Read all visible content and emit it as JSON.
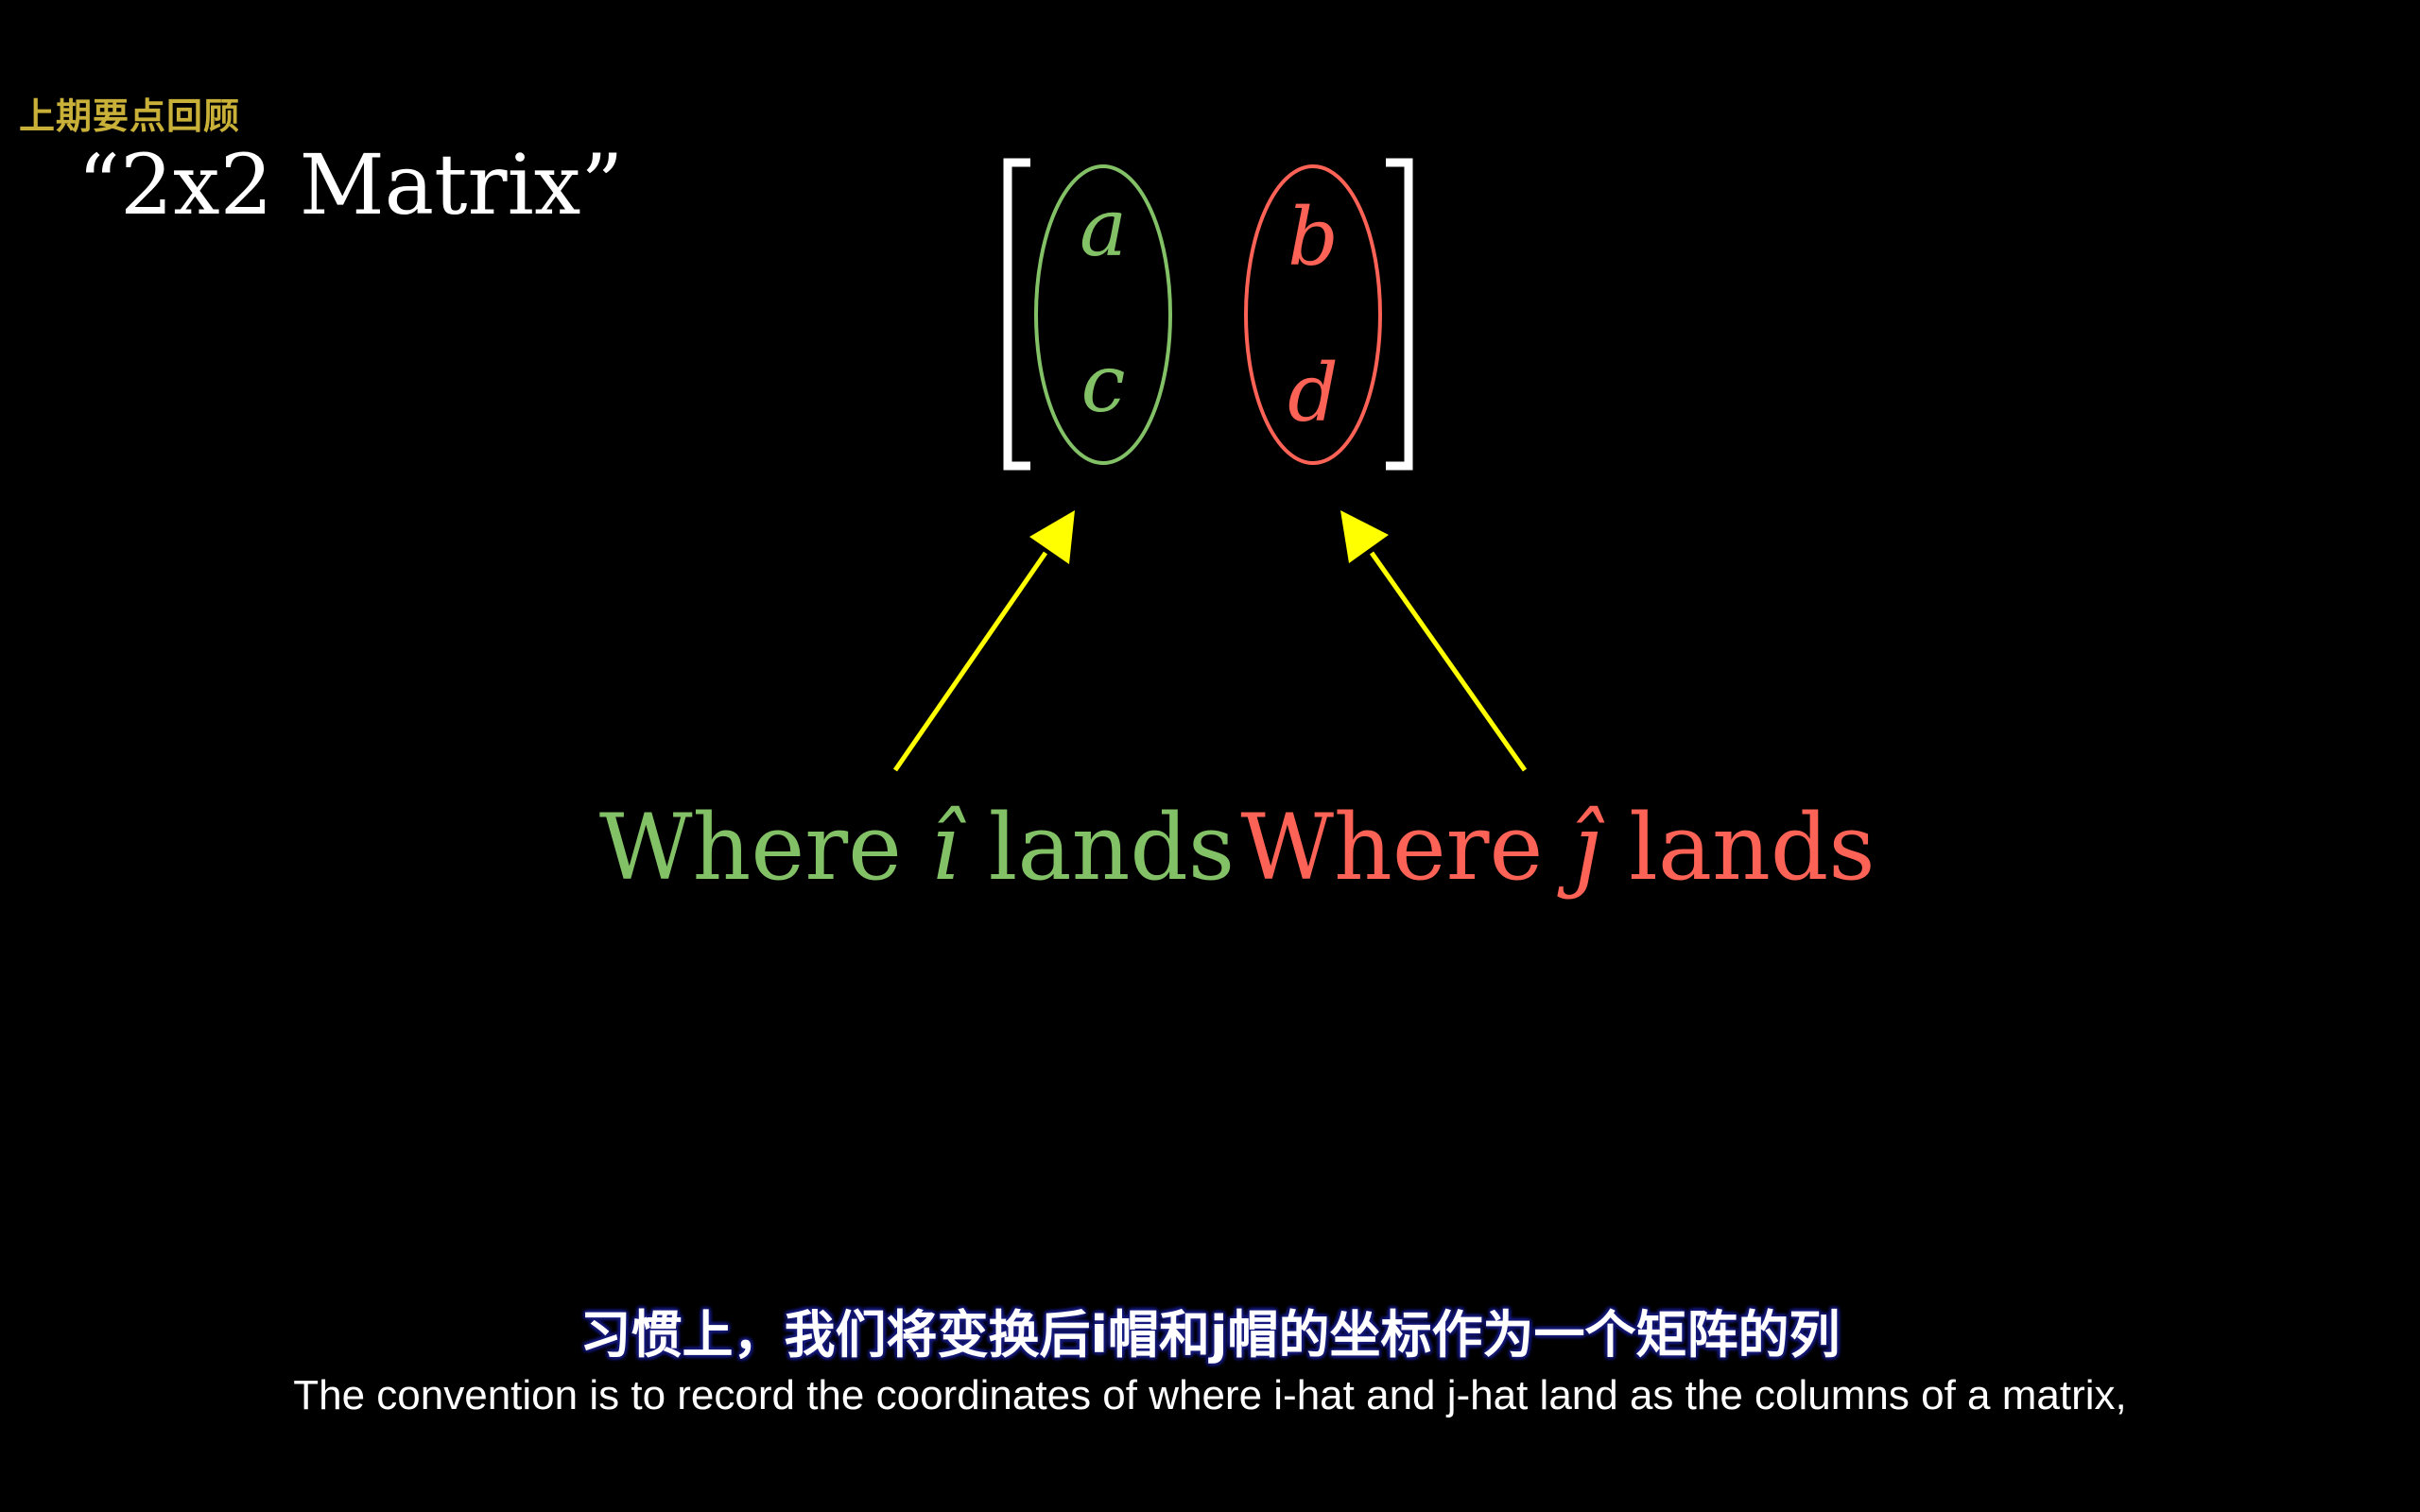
{
  "header": {
    "recap_label": "上期要点回顾",
    "title": "“2x2 Matrix”"
  },
  "matrix": {
    "column1": [
      "a",
      "c"
    ],
    "column2": [
      "b",
      "d"
    ]
  },
  "labels": {
    "i_hat": {
      "prefix": "Where ",
      "symbol": "î",
      "suffix": " lands"
    },
    "j_hat": {
      "prefix": "Where ",
      "symbol": "ĵ",
      "suffix": " lands"
    }
  },
  "subtitles": {
    "chinese": "习惯上，我们将变换后i帽和j帽的坐标作为一个矩阵的列",
    "english": "The convention is to record the coordinates of where i-hat and j-hat land as the columns of a matrix,"
  },
  "colors": {
    "background": "#000000",
    "recap_label": "#c9b038",
    "i_hat_green": "#83c167",
    "j_hat_red": "#fc6255",
    "arrow_yellow": "#ffff00",
    "bracket_white": "#ffffff"
  },
  "icons": {
    "arrow_to_column1": "arrow-up-right-icon",
    "arrow_to_column2": "arrow-up-left-icon"
  }
}
